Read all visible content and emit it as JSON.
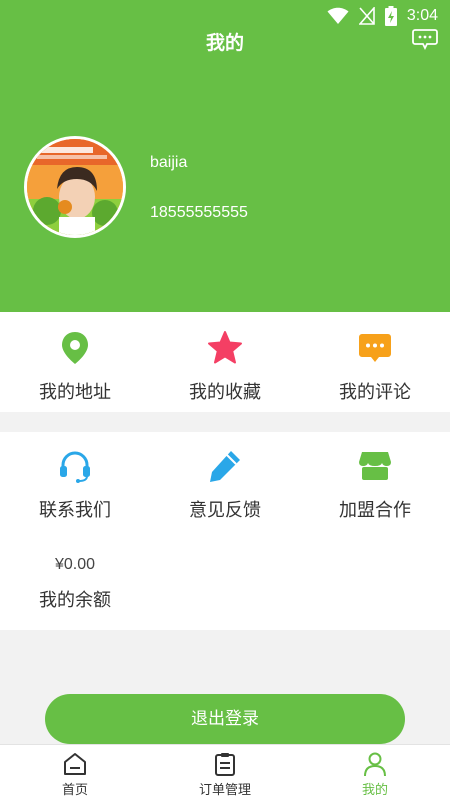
{
  "status_bar": {
    "time": "3:04"
  },
  "header": {
    "title": "我的"
  },
  "profile": {
    "username": "baijia",
    "phone": "18555555555"
  },
  "menu_row1": [
    {
      "label": "我的地址",
      "icon": "location-pin-icon",
      "color": "#67bf45"
    },
    {
      "label": "我的收藏",
      "icon": "star-icon",
      "color": "#f43f64"
    },
    {
      "label": "我的评论",
      "icon": "comment-icon",
      "color": "#f7a11a"
    }
  ],
  "menu_row2": [
    {
      "label": "联系我们",
      "icon": "headset-icon",
      "color": "#2aa7e8"
    },
    {
      "label": "意见反馈",
      "icon": "pencil-icon",
      "color": "#2aa7e8"
    },
    {
      "label": "加盟合作",
      "icon": "shop-icon",
      "color": "#67bf45"
    }
  ],
  "balance": {
    "amount": "¥0.00",
    "label": "我的余额"
  },
  "logout_label": "退出登录",
  "tabs": [
    {
      "label": "首页",
      "icon": "home-icon"
    },
    {
      "label": "订单管理",
      "icon": "clipboard-icon"
    },
    {
      "label": "我的",
      "icon": "user-icon",
      "active": true
    }
  ],
  "colors": {
    "primary": "#67bf45"
  }
}
